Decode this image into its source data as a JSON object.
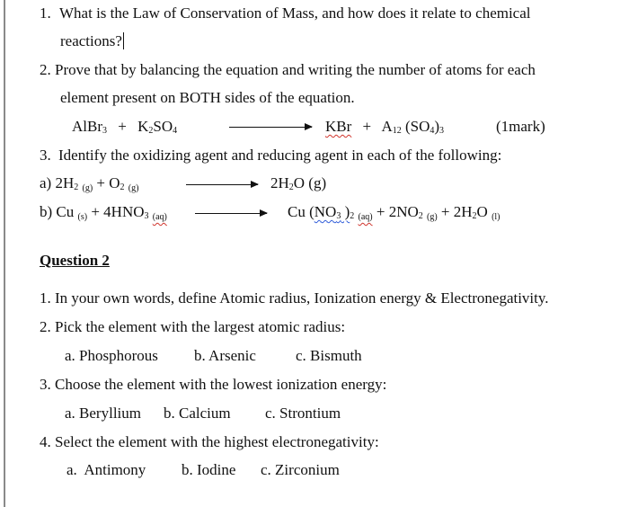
{
  "question1": {
    "items": [
      {
        "num": "1.",
        "text_line1": "What is the Law of Conservation of Mass, and how does it relate to chemical",
        "text_line2": "reactions?"
      },
      {
        "num": "2.",
        "text_line1": "Prove that by balancing the equation and writing the number of atoms for each",
        "text_line2": "element present on BOTH sides of the equation."
      },
      {
        "num": "3.",
        "text_line1": "Identify the oxidizing agent and reducing agent in each of the following:"
      }
    ],
    "equation": {
      "reactant1": {
        "base": "AlBr",
        "sub": "3"
      },
      "plus": "+",
      "reactant2": {
        "a": "K",
        "sub1": "2",
        "b": "SO",
        "sub2": "4"
      },
      "product1": "KBr",
      "product2": {
        "a": "A",
        "sub1": "12",
        "b": " (SO",
        "sub2": "4",
        "c": ")",
        "sub3": "3"
      },
      "marks": "(1mark)"
    },
    "reactions": [
      {
        "label": "a)",
        "lhs": {
          "coef1": "2H",
          "sub1": "2",
          "state1": "(g)",
          "plus": "+",
          "sp2": "O",
          "sub2": "2",
          "state2": "(g)"
        },
        "rhs": {
          "coef": "2H",
          "sub": "2",
          "rest": "O (g)"
        }
      },
      {
        "label": "b)",
        "lhs": {
          "sp1": "Cu",
          "state1": "(s)",
          "plus": "+",
          "sp2": "4HNO",
          "sub2": "3",
          "state2": "(aq)"
        },
        "rhs": {
          "sp1": "Cu (",
          "ul": "NO",
          "ulsub": "3",
          "close": " )",
          "sub1": "2",
          "state1": "(aq)",
          "plus1": "+",
          "sp2": "2NO",
          "sub2": "2",
          "state2": "(g)",
          "plus2": "+",
          "sp3": "2H",
          "sub3": "2",
          "sp3b": "O",
          "state3": "(l)"
        }
      }
    ]
  },
  "question2": {
    "heading": "Question 2",
    "items": [
      {
        "num": "1.",
        "text": "In your own words, define Atomic radius, Ionization energy & Electronegativity."
      },
      {
        "num": "2.",
        "text": "Pick the element with the largest atomic radius:",
        "options": [
          "a. Phosphorous",
          "b. Arsenic",
          "c. Bismuth"
        ]
      },
      {
        "num": "3.",
        "text": "Choose the element with the lowest ionization energy:",
        "options": [
          "a. Beryllium",
          "b. Calcium",
          "c. Strontium"
        ]
      },
      {
        "num": "4.",
        "text": "Select the element with the highest electronegativity:",
        "options": [
          "a.  Antimony",
          "b. Iodine",
          "c. Zirconium"
        ]
      }
    ]
  },
  "colors": {
    "spell_error": "#d0342c",
    "grammar_error": "#2e5bd8",
    "text": "#111111"
  }
}
